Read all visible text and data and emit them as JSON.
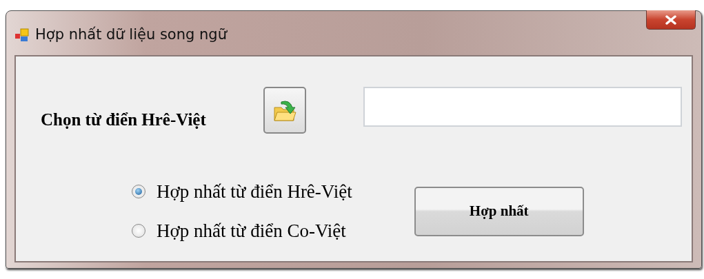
{
  "window": {
    "title": "Hợp nhất dữ liệu song ngữ"
  },
  "dictionary": {
    "label": "Chọn từ điển Hrê-Việt"
  },
  "options": [
    {
      "label": "Hợp nhất từ điển Hrê-Việt",
      "selected": true
    },
    {
      "label": "Hợp nhất từ điển Co-Việt",
      "selected": false
    }
  ],
  "buttons": [
    "Hợp nhất"
  ]
}
